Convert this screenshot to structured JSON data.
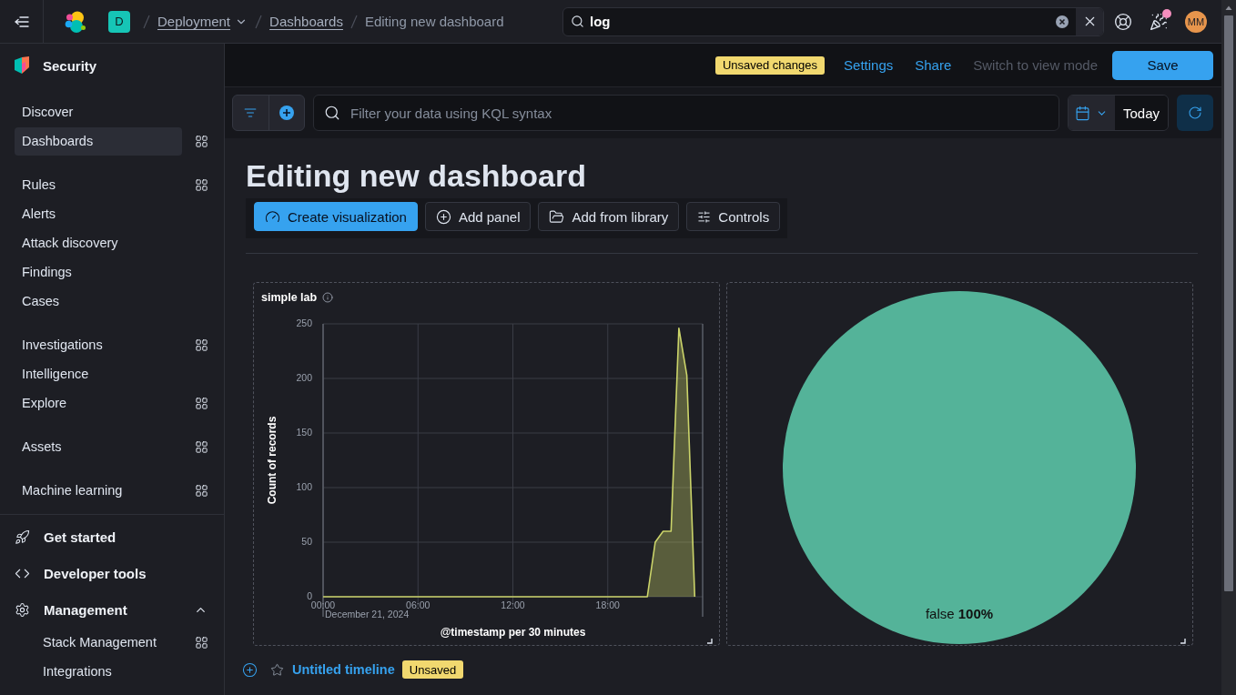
{
  "header": {
    "space": "D",
    "breadcrumbs": [
      {
        "label": "Deployment",
        "kind": "menu"
      },
      {
        "label": "Dashboards",
        "kind": "link"
      },
      {
        "label": "Editing new dashboard",
        "kind": "current"
      }
    ],
    "search": {
      "value": "log"
    },
    "news_dot": true,
    "avatar": "MM"
  },
  "sidebar": {
    "title": "Security",
    "groups": [
      {
        "items": [
          {
            "label": "Discover",
            "selected": false,
            "panel_opener": false
          },
          {
            "label": "Dashboards",
            "selected": true,
            "panel_opener": true
          }
        ]
      },
      {
        "items": [
          {
            "label": "Rules",
            "selected": false,
            "panel_opener": true
          },
          {
            "label": "Alerts",
            "selected": false,
            "panel_opener": false
          },
          {
            "label": "Attack discovery",
            "selected": false,
            "panel_opener": false
          },
          {
            "label": "Findings",
            "selected": false,
            "panel_opener": false
          },
          {
            "label": "Cases",
            "selected": false,
            "panel_opener": false
          }
        ]
      },
      {
        "items": [
          {
            "label": "Investigations",
            "selected": false,
            "panel_opener": true
          },
          {
            "label": "Intelligence",
            "selected": false,
            "panel_opener": false
          },
          {
            "label": "Explore",
            "selected": false,
            "panel_opener": true
          }
        ]
      },
      {
        "items": [
          {
            "label": "Assets",
            "selected": false,
            "panel_opener": true
          }
        ]
      },
      {
        "items": [
          {
            "label": "Machine learning",
            "selected": false,
            "panel_opener": true
          }
        ]
      }
    ],
    "footer": [
      {
        "label": "Get started",
        "kind": "link",
        "selected": false
      },
      {
        "label": "Developer tools",
        "kind": "link",
        "selected": false
      },
      {
        "label": "Management",
        "kind": "section",
        "selected": false,
        "expanded": true,
        "children": [
          {
            "label": "Stack Management",
            "selected": false,
            "panel_opener": true
          },
          {
            "label": "Integrations",
            "selected": false,
            "panel_opener": false
          }
        ]
      }
    ]
  },
  "dashboard_bar": {
    "status": "Unsaved changes",
    "actions": [
      {
        "label": "Settings",
        "disabled": false
      },
      {
        "label": "Share",
        "disabled": false
      },
      {
        "label": "Switch to view mode",
        "disabled": true
      }
    ],
    "save": "Save"
  },
  "query_bar": {
    "placeholder": "Filter your data using KQL syntax",
    "date": "Today"
  },
  "dashboard": {
    "title": "Editing new dashboard",
    "toolbar": [
      {
        "label": "Create visualization",
        "primary": true
      },
      {
        "label": "Add panel",
        "primary": false
      },
      {
        "label": "Add from library",
        "primary": false
      },
      {
        "label": "Controls",
        "primary": false
      }
    ],
    "panels": [
      {
        "chart_data": {
          "type": "area",
          "title": "simple lab",
          "xlabel": "@timestamp per 30 minutes",
          "ylabel": "Count of records",
          "x": [
            0,
            0.5,
            1,
            1.5,
            2,
            2.5,
            3,
            3.5,
            4,
            4.5,
            5,
            5.5,
            6,
            6.5,
            7,
            7.5,
            8,
            8.5,
            9,
            9.5,
            10,
            10.5,
            11,
            11.5,
            12,
            12.5,
            13,
            13.5,
            14,
            14.5,
            15,
            15.5,
            16,
            16.5,
            17,
            17.5,
            18,
            18.5,
            19,
            19.5,
            20,
            20.5,
            21,
            21.5,
            22,
            22.5,
            23,
            23.5
          ],
          "values": [
            0,
            0,
            0,
            0,
            0,
            0,
            0,
            0,
            0,
            0,
            0,
            0,
            0,
            0,
            0,
            0,
            0,
            0,
            0,
            0,
            0,
            0,
            0,
            0,
            0,
            0,
            0,
            0,
            0,
            0,
            0,
            0,
            0,
            0,
            0,
            0,
            0,
            0,
            0,
            0,
            0,
            0,
            50,
            60,
            60,
            246,
            203,
            0
          ],
          "color": "#cbd46a",
          "xlim": [
            0,
            24
          ],
          "ylim": [
            0,
            250
          ],
          "xticks": [
            {
              "value": 0,
              "label": "00:00"
            },
            {
              "value": 6,
              "label": "06:00"
            },
            {
              "value": 12,
              "label": "12:00"
            },
            {
              "value": 18,
              "label": "18:00"
            }
          ],
          "yticks": [
            0,
            50,
            100,
            150,
            200,
            250
          ],
          "grid": true,
          "annotations": [
            "December 21, 2024"
          ]
        }
      },
      {
        "chart_data": {
          "type": "pie",
          "categories": [
            "false"
          ],
          "values": [
            100
          ],
          "colors": [
            "#54b399"
          ],
          "value_labels": [
            "100%"
          ]
        }
      }
    ]
  },
  "timeline": {
    "title": "Untitled timeline",
    "favorite": false,
    "badge": "Unsaved"
  }
}
